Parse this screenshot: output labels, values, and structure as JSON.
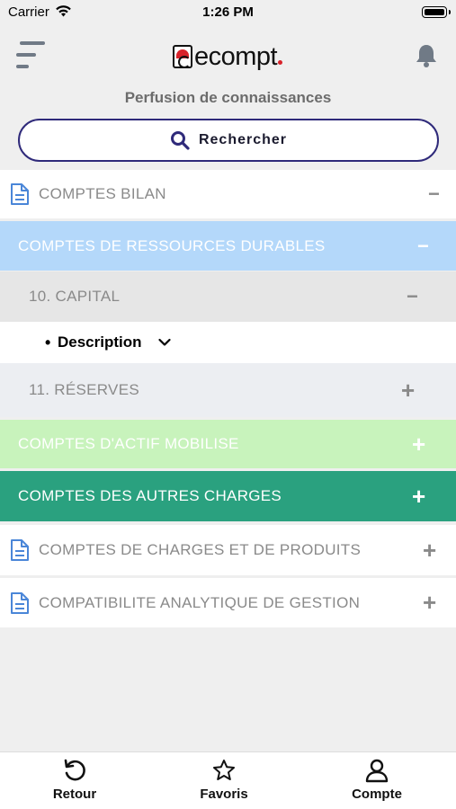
{
  "status_bar": {
    "carrier": "Carrier",
    "time": "1:26 PM"
  },
  "header": {
    "logo_text": "ecompt",
    "subtitle": "Perfusion de connaissances",
    "search_label": "Rechercher"
  },
  "rows": {
    "bilan": {
      "label": "COMPTES BILAN",
      "sign": "−"
    },
    "ressources": {
      "label": "COMPTES DE RESSOURCES DURABLES",
      "sign": "−"
    },
    "capital": {
      "label": "10. CAPITAL",
      "sign": "−"
    },
    "description": {
      "bullet": "•",
      "label": "Description"
    },
    "reserves": {
      "label": "11. RÉSERVES",
      "sign": "+"
    },
    "actif": {
      "label": "COMPTES D'ACTIF MOBILISE",
      "sign": "+"
    },
    "autres": {
      "label": "COMPTES DES AUTRES CHARGES",
      "sign": "+"
    },
    "produits": {
      "label": "COMPTES DE CHARGES ET DE PRODUITS",
      "sign": "+"
    },
    "analytique": {
      "label": "COMPATIBILITE ANALYTIQUE DE GESTION",
      "sign": "+"
    }
  },
  "tabs": [
    {
      "label": "Retour",
      "icon": "undo-icon"
    },
    {
      "label": "Favoris",
      "icon": "star-icon"
    },
    {
      "label": "Compte",
      "icon": "user-icon"
    }
  ],
  "colors": {
    "accent": "#2f2a7a",
    "ressources_bg": "#b4d8fa",
    "actif_bg": "#c8f3bc",
    "autres_bg": "#2aa17f",
    "logo_red": "#d8222a"
  }
}
